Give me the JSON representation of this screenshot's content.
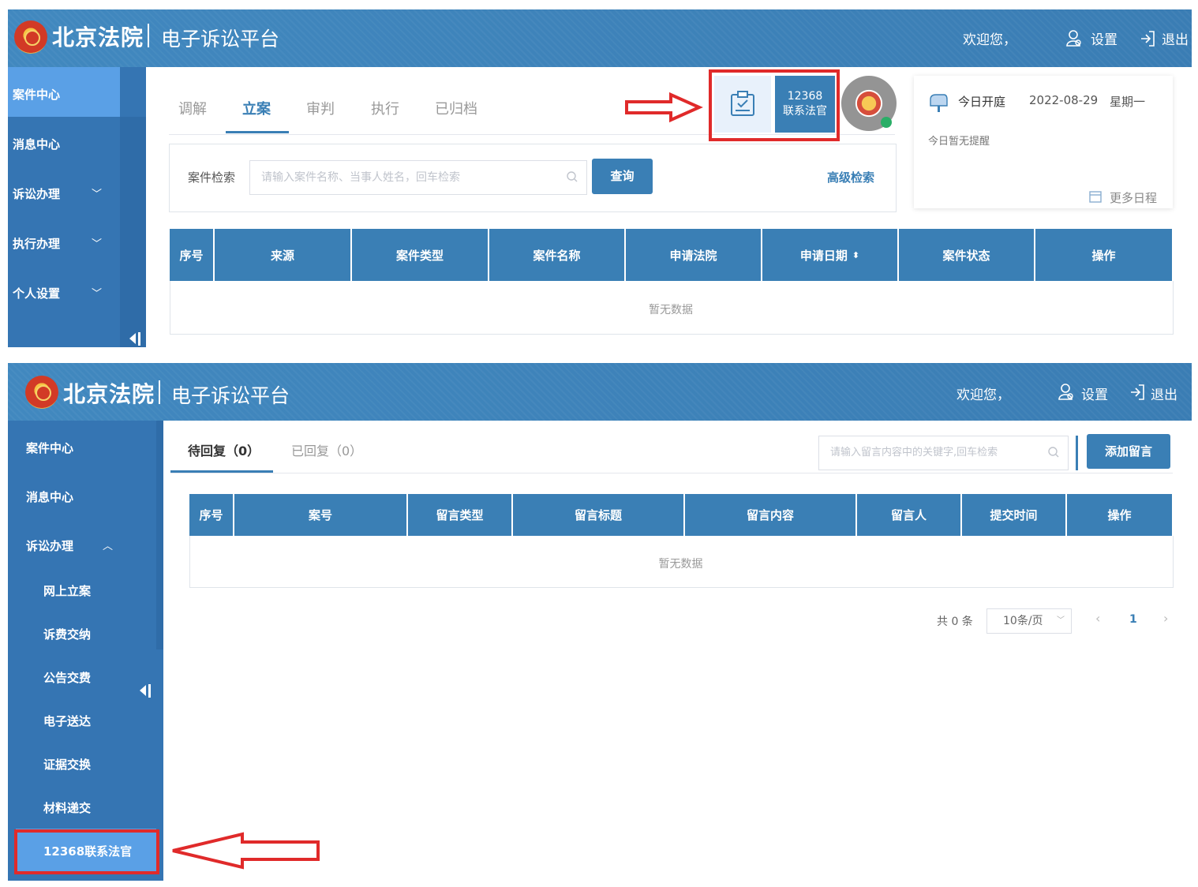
{
  "panel1": {
    "header": {
      "brand": "北京法院",
      "platform": "电子诉讼平台",
      "welcome": "欢迎您，",
      "settings": "设置",
      "logout": "退出"
    },
    "sidebar": {
      "items": [
        {
          "label": "案件中心"
        },
        {
          "label": "消息中心"
        },
        {
          "label": "诉讼办理"
        },
        {
          "label": "执行办理"
        },
        {
          "label": "个人设置"
        }
      ]
    },
    "tabs": [
      "调解",
      "立案",
      "审判",
      "执行",
      "已归档"
    ],
    "search": {
      "label": "案件检索",
      "placeholder": "请输入案件名称、当事人姓名，回车检索",
      "button": "查询",
      "advanced": "高级检索"
    },
    "contact_tile": {
      "line1": "12368",
      "line2": "联系法官"
    },
    "calendar": {
      "title": "今日开庭",
      "date": "2022-08-29",
      "weekday": "星期一",
      "note": "今日暂无提醒",
      "more": "更多日程"
    },
    "table": {
      "headers": [
        "序号",
        "来源",
        "案件类型",
        "案件名称",
        "申请法院",
        "申请日期",
        "案件状态",
        "操作"
      ],
      "empty": "暂无数据"
    }
  },
  "panel2": {
    "header": {
      "brand": "北京法院",
      "platform": "电子诉讼平台",
      "welcome": "欢迎您，",
      "settings": "设置",
      "logout": "退出"
    },
    "sidebar": {
      "items": [
        {
          "label": "案件中心"
        },
        {
          "label": "消息中心"
        },
        {
          "label": "诉讼办理"
        },
        {
          "label": "网上立案"
        },
        {
          "label": "诉费交纳"
        },
        {
          "label": "公告交费"
        },
        {
          "label": "电子送达"
        },
        {
          "label": "证据交换"
        },
        {
          "label": "材料递交"
        },
        {
          "label": "12368联系法官"
        }
      ]
    },
    "tabs": [
      "待回复（0）",
      "已回复（0）"
    ],
    "search": {
      "placeholder": "请输入留言内容中的关键字,回车检索",
      "button": "添加留言"
    },
    "table": {
      "headers": [
        "序号",
        "案号",
        "留言类型",
        "留言标题",
        "留言内容",
        "留言人",
        "提交时间",
        "操作"
      ],
      "empty": "暂无数据"
    },
    "pagination": {
      "total": "共 0 条",
      "page_size": "10条/页",
      "current_page": "1"
    }
  },
  "colors": {
    "header_blue": "#3d81b8",
    "sidebar_blue": "#3575b3",
    "active_blue": "#5aa0e6",
    "table_head": "#3a7fb5",
    "highlight_red": "#e02a2a"
  }
}
